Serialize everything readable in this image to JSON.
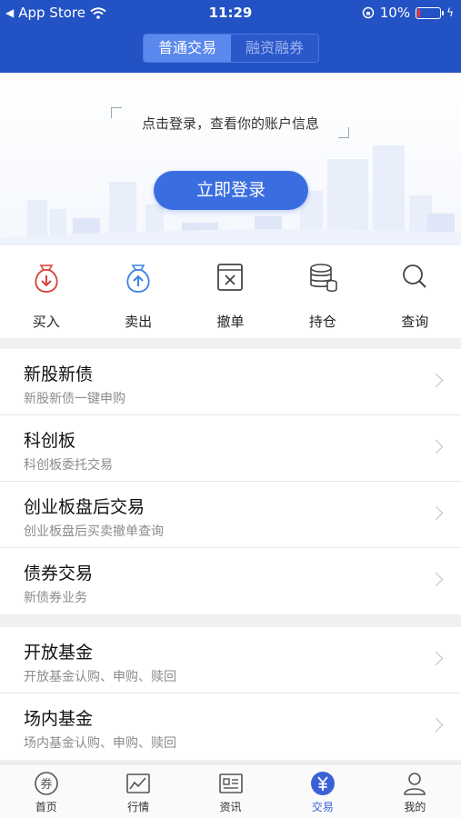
{
  "status_bar": {
    "carrier": "App Store",
    "time": "11:29",
    "battery": "10%"
  },
  "segment": {
    "tabs": [
      "普通交易",
      "融资融券"
    ],
    "active": 0
  },
  "login": {
    "tip": "点击登录，查看你的账户信息",
    "button": "立即登录"
  },
  "actions": [
    {
      "label": "买入",
      "icon": "buy-bag-icon"
    },
    {
      "label": "卖出",
      "icon": "sell-bag-icon"
    },
    {
      "label": "撤单",
      "icon": "cancel-order-icon"
    },
    {
      "label": "持仓",
      "icon": "coin-stack-icon"
    },
    {
      "label": "查询",
      "icon": "search-icon"
    }
  ],
  "menu_group_1": [
    {
      "title": "新股新债",
      "subtitle": "新股新债一键申购"
    },
    {
      "title": "科创板",
      "subtitle": "科创板委托交易"
    },
    {
      "title": "创业板盘后交易",
      "subtitle": "创业板盘后买卖撤单查询"
    },
    {
      "title": "债券交易",
      "subtitle": "新债券业务"
    }
  ],
  "menu_group_2": [
    {
      "title": "开放基金",
      "subtitle": "开放基金认购、申购、赎回"
    },
    {
      "title": "场内基金",
      "subtitle": "场内基金认购、申购、赎回"
    }
  ],
  "tab_bar": [
    {
      "label": "首页",
      "icon": "home-coupon-icon"
    },
    {
      "label": "行情",
      "icon": "market-chart-icon"
    },
    {
      "label": "资讯",
      "icon": "news-icon"
    },
    {
      "label": "交易",
      "icon": "trade-yen-icon"
    },
    {
      "label": "我的",
      "icon": "profile-icon"
    }
  ],
  "active_tab": 3,
  "colors": {
    "brand": "#2352c4",
    "accent": "#3a6ee0",
    "sell": "#3b82e6",
    "buy": "#d9423a"
  }
}
